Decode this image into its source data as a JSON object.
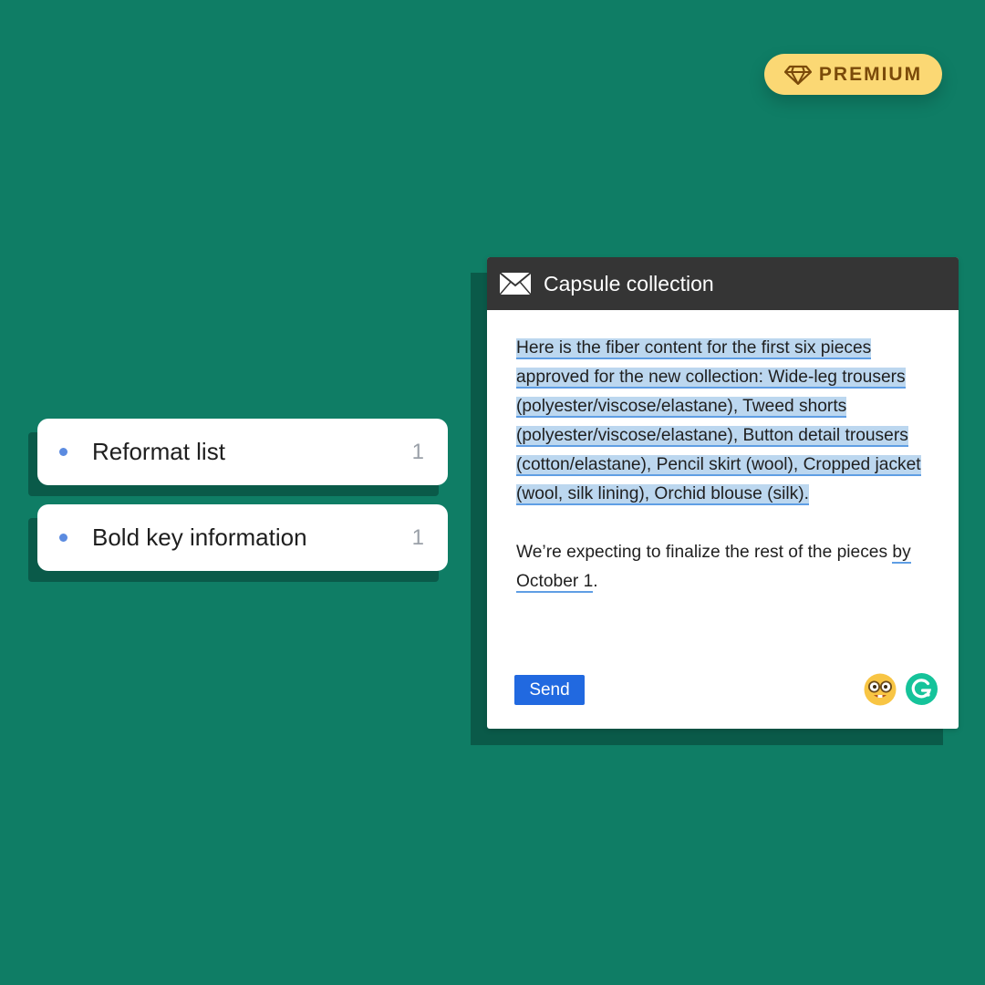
{
  "badge": {
    "label": "PREMIUM",
    "icon": "diamond-icon"
  },
  "suggestions": [
    {
      "label": "Reformat list",
      "count": "1"
    },
    {
      "label": "Bold key information",
      "count": "1"
    }
  ],
  "email": {
    "title": "Capsule collection",
    "icon": "envelope-icon",
    "paragraph1": "Here is the fiber content for the first six pieces approved for the new collection: Wide-leg trousers (polyester/viscose/elastane), Tweed shorts (polyester/viscose/elastane), Button detail trousers (cotton/elastane), Pencil skirt (wool), Cropped jacket (wool, silk lining), Orchid blouse (silk).",
    "paragraph2_start": "We’re expecting to finalize the rest of the pieces ",
    "paragraph2_highlight": "by October 1",
    "paragraph2_end": ".",
    "send_label": "Send"
  },
  "colors": {
    "background": "#0f7d65",
    "badge": "#fbd874",
    "highlight": "#bcd7ef",
    "underline": "#5f9ee4",
    "send_button": "#2169e0",
    "titlebar": "#353535",
    "grammarly": "#15c39a"
  }
}
